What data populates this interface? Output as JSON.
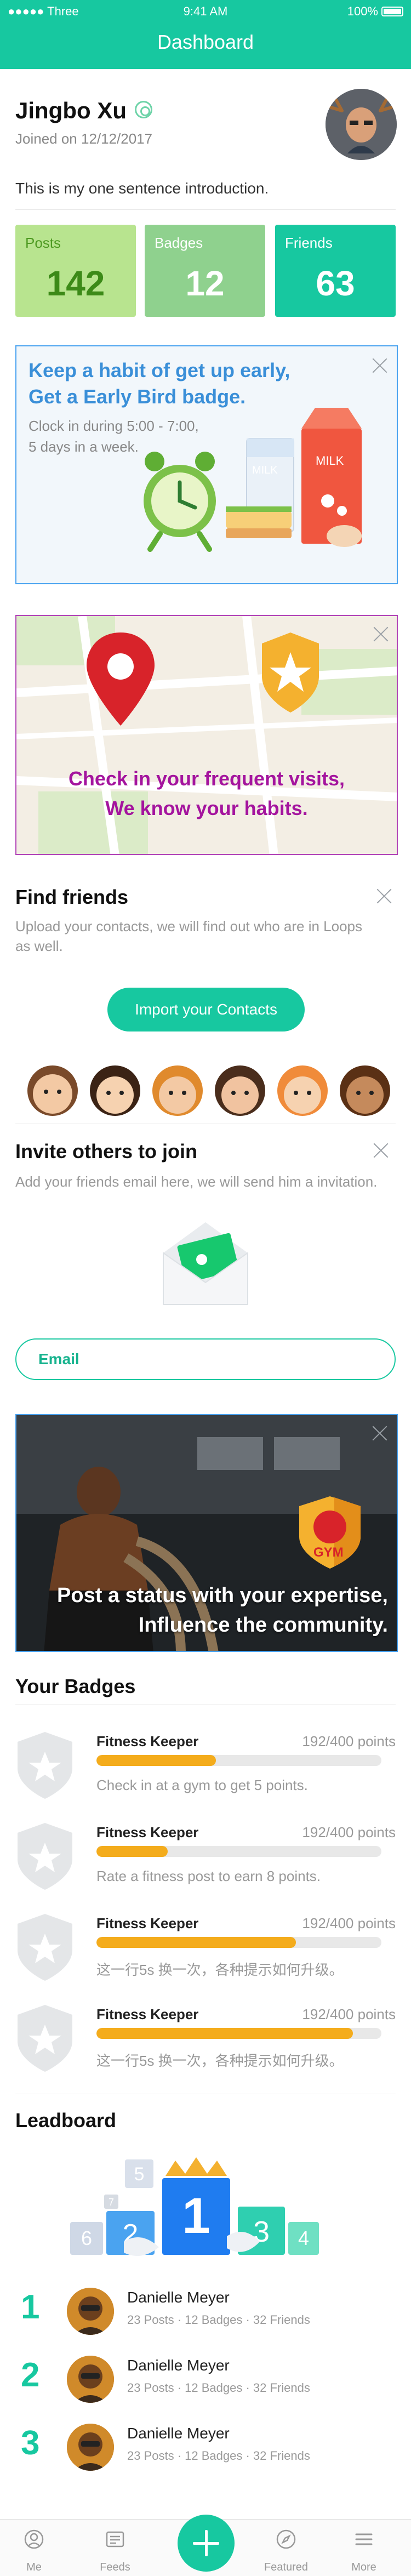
{
  "status_bar": {
    "carrier": "●●●●● Three",
    "time": "9:41 AM",
    "battery": "100%"
  },
  "header": {
    "title": "Dashboard"
  },
  "profile": {
    "name": "Jingbo Xu",
    "joined": "Joined on 12/12/2017",
    "intro": "This is my one sentence introduction."
  },
  "stats": [
    {
      "label": "Posts",
      "value": "142"
    },
    {
      "label": "Badges",
      "value": "12"
    },
    {
      "label": "Friends",
      "value": "63"
    }
  ],
  "early_bird": {
    "title_line1": "Keep a habit of get up early,",
    "title_line2": "Get a Early Bird badge.",
    "desc_line1": "Clock in during 5:00 - 7:00,",
    "desc_line2": "5 days in a week.",
    "milk_label": "MILK"
  },
  "visits": {
    "line1": "Check in your frequent visits,",
    "line2": "We know your habits."
  },
  "find_friends": {
    "title": "Find friends",
    "desc_line1": "Upload your contacts, we will find out who are in Loops",
    "desc_line2": "as well.",
    "button": "Import your Contacts"
  },
  "invite": {
    "title": "Invite others to join",
    "desc": "Add your friends email here, we will send him a invitation.",
    "email_placeholder": "Email"
  },
  "gym": {
    "line1": "Post a status with your expertise,",
    "line2": "Influence the community.",
    "logo_text": "GYM"
  },
  "badges": {
    "title": "Your Badges",
    "items": [
      {
        "name": "Fitness Keeper",
        "points": "192/400 points",
        "desc": "Check in at a gym to get 5 points.",
        "progress": 0.42
      },
      {
        "name": "Fitness Keeper",
        "points": "192/400 points",
        "desc": "Rate a fitness post to earn 8 points.",
        "progress": 0.25
      },
      {
        "name": "Fitness Keeper",
        "points": "192/400 points",
        "desc": "这一行5s 换一次，各种提示如何升级。",
        "progress": 0.7
      },
      {
        "name": "Fitness Keeper",
        "points": "192/400 points",
        "desc": "这一行5s 换一次，各种提示如何升级。",
        "progress": 0.9
      }
    ]
  },
  "leaderboard": {
    "title": "Leadboard",
    "podium": [
      "5",
      "7",
      "6",
      "2",
      "1",
      "3",
      "4"
    ],
    "rows": [
      {
        "rank": "1",
        "name": "Danielle Meyer",
        "meta": "23 Posts · 12 Badges · 32 Friends"
      },
      {
        "rank": "2",
        "name": "Danielle Meyer",
        "meta": "23 Posts · 12 Badges · 32 Friends"
      },
      {
        "rank": "3",
        "name": "Danielle Meyer",
        "meta": "23 Posts · 12 Badges · 32 Friends"
      }
    ]
  },
  "tabbar": {
    "me": "Me",
    "feeds": "Feeds",
    "featured": "Featured",
    "more": "More"
  },
  "colors": {
    "accent": "#17c8a0",
    "badge_fill": "#f4ac1c",
    "blue": "#3a8fd8",
    "magenta": "#a4149e"
  }
}
